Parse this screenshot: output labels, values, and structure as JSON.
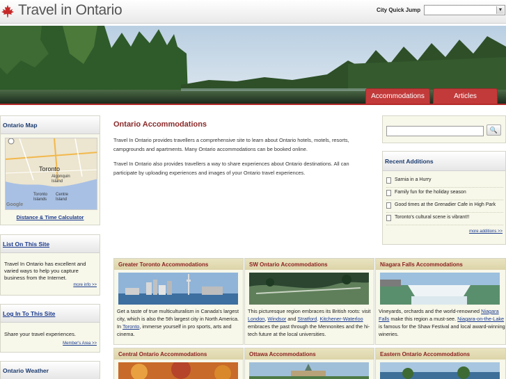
{
  "header": {
    "site_title": "Travel in Ontario",
    "quick_jump_label": "City Quick Jump",
    "quick_jump_value": ""
  },
  "nav": {
    "tabs": [
      {
        "label": "Accommodations"
      },
      {
        "label": "Articles"
      }
    ]
  },
  "sidebar": {
    "map_box": {
      "title": "Ontario Map",
      "map_labels": [
        "Toronto",
        "Algonquin Island",
        "Toronto Islands",
        "Centre Island"
      ],
      "google_label": "Google",
      "link": "Distance & Time Calculator"
    },
    "list_box": {
      "title": "List On This Site",
      "text": "Travel In Ontario has excellent and varied ways to help you capture business from the Internet.",
      "more": "more info >>"
    },
    "login_box": {
      "title": "Log In To This Site",
      "text": "Share your travel experiences.",
      "more": "Member's Area >>"
    },
    "weather_box": {
      "title": "Ontario Weather"
    }
  },
  "main": {
    "title": "Ontario Accommodations",
    "paragraphs": [
      "Travel In Ontario provides travellers a comprehensive site to learn about Ontario hotels, motels, resorts, campgrounds and apartments. Many Ontario accommodations can be booked online.",
      "Travel In Ontario also provides travellers a way to share experiences about Ontario destinations. All can participate by uploading experiences and images of your Ontario travel experiences."
    ]
  },
  "right": {
    "search_value": "",
    "search_button": "🔍",
    "recent_title": "Recent Additions",
    "recent_items": [
      "Sarnia in a Hurry",
      "Family fun for the holiday season",
      "Good times at the Grenadier Cafe in High Park",
      "Toronto's cultural scene is vibrant!!"
    ],
    "recent_more": "more additions >>"
  },
  "cards": [
    {
      "title": "Greater Toronto Accommodations",
      "text_before": "Get a taste of true multiculturalism in Canada's largest city, which is also the 5th largest city in North America. In ",
      "link1": "Toronto",
      "text_after": ", immerse yourself in pro sports, arts and cinema."
    },
    {
      "title": "SW Ontario Accommodations",
      "text_before": "This picturesque region embraces its British roots: visit ",
      "link1": "London",
      "sep1": ", ",
      "link2": "Windsor",
      "sep2": " and ",
      "link3": "Stratford",
      "sep3": ". ",
      "link4": "Kitchener-Waterloo",
      "text_after": " embraces the past through the Mennonites and the hi-tech future at the local universities."
    },
    {
      "title": "Niagara Falls Accommodations",
      "text_before": "Vineyards, orchards and the world-renowned ",
      "link1": "Niagara Falls",
      "text_mid": " make this region a must-see. ",
      "link2": "Niagara-on-the-Lake",
      "text_after": " is famous for the Shaw Festival and local award-winning wineries."
    },
    {
      "title": "Central Ontario Accommodations"
    },
    {
      "title": "Ottawa Accommodations"
    },
    {
      "title": "Eastern Ontario Accommodations"
    }
  ],
  "colors": {
    "brand_red": "#c23a3a",
    "title_red": "#8b2a2a",
    "link_blue": "#1a3a8e",
    "panel_bg": "#f7f7ea"
  }
}
